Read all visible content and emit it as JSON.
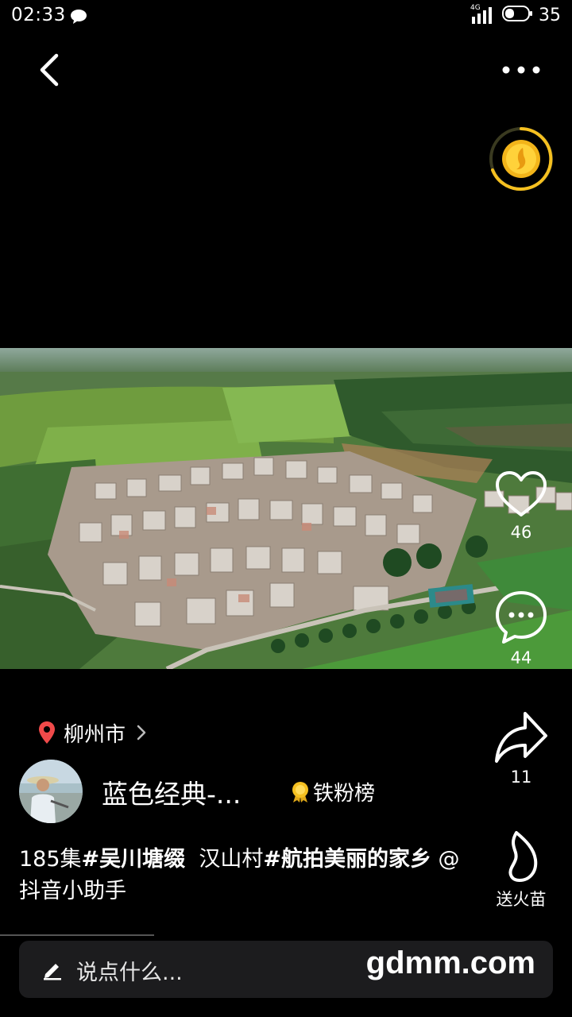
{
  "status_bar": {
    "time": "02:33",
    "network": "4G",
    "battery": "35"
  },
  "location": {
    "text": "柳州市"
  },
  "author": {
    "name": "蓝色经典-...",
    "badge_label": "铁粉榜"
  },
  "caption": {
    "prefix": "185集",
    "tag1": "#吴川塘缀",
    "middle": "汉山村",
    "tag2": "#航拍美丽的家乡",
    "mention": " @抖音小助手"
  },
  "actions": {
    "like_count": "46",
    "comment_count": "44",
    "share_count": "11",
    "gift_label": "送火苗"
  },
  "comment_input": {
    "placeholder": "说点什么..."
  },
  "watermark": "gdmm.com",
  "colors": {
    "background": "#000000",
    "location_pin": "#f04a4a",
    "coin": "#f5c020",
    "input_bg": "#1c1c1e"
  }
}
